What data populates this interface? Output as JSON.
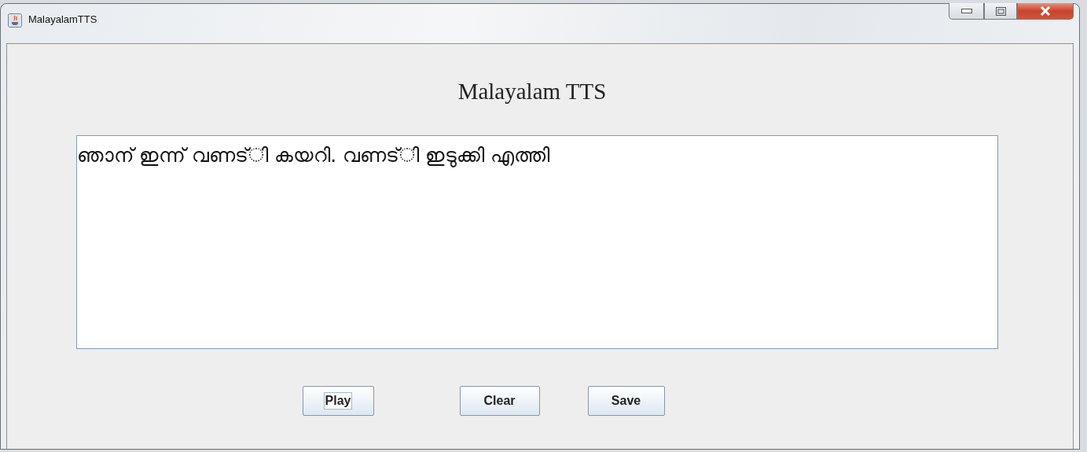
{
  "window": {
    "title": "MalayalamTTS"
  },
  "heading": "Malayalam TTS",
  "text_area": {
    "value": "ഞാന് ഇന്ന് വണട്ി കയറി. വണട്ി ഇടുക്കി എത്തി"
  },
  "buttons": [
    {
      "label": "Play",
      "focused": true
    },
    {
      "label": "Clear",
      "focused": false
    },
    {
      "label": "Save",
      "focused": false
    }
  ]
}
